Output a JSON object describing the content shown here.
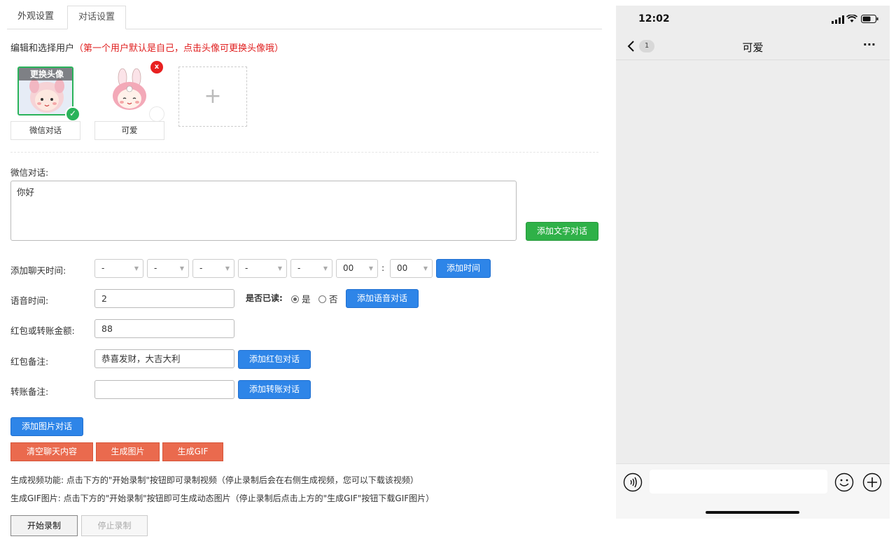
{
  "tabs": [
    "外观设置",
    "对话设置"
  ],
  "header": {
    "prefix": "编辑和选择用户",
    "note": "（第一个用户默认是自己，点击头像可更换头像哦）"
  },
  "users": [
    {
      "name": "微信对话",
      "overlay": "更换头像",
      "selected": true
    },
    {
      "name": "可爱",
      "overlay": "",
      "selected": false
    }
  ],
  "add_user_symbol": "+",
  "dialog": {
    "label": "微信对话:",
    "value": "你好",
    "add_button": "添加文字对话"
  },
  "time": {
    "label": "添加聊天时间:",
    "selects": [
      "-",
      "-",
      "-",
      "-",
      "-",
      "00",
      "00"
    ],
    "colon": ":",
    "add_button": "添加时间"
  },
  "voice": {
    "label": "语音时间:",
    "value": "2",
    "read_label": "是否已读:",
    "yes": "是",
    "no": "否",
    "read": "yes",
    "add_button": "添加语音对话"
  },
  "amount": {
    "label": "红包或转账金额:",
    "value": "88"
  },
  "redpacket": {
    "label": "红包备注:",
    "value": "恭喜发财，大吉大利",
    "add_button": "添加红包对话"
  },
  "transfer": {
    "label": "转账备注:",
    "value": "",
    "add_button": "添加转账对话"
  },
  "image_button": "添加图片对话",
  "actions": {
    "clear": "清空聊天内容",
    "gen_image": "生成图片",
    "gen_gif": "生成GIF"
  },
  "info": {
    "video": "生成视频功能: 点击下方的\"开始录制\"按钮即可录制视频（停止录制后会在右侧生成视频，您可以下载该视频）",
    "gif": "生成GIF图片: 点击下方的\"开始录制\"按钮即可生成动态图片（停止录制后点击上方的\"生成GIF\"按钮下载GIF图片）"
  },
  "record": {
    "start": "开始录制",
    "stop": "停止录制"
  },
  "phone": {
    "time": "12:02",
    "title": "可爱",
    "unread": "1",
    "more": "···"
  },
  "colors": {
    "blue": "#2e85e8",
    "green": "#2fb148",
    "orange": "#ea6a4e",
    "red": "#e02020"
  }
}
